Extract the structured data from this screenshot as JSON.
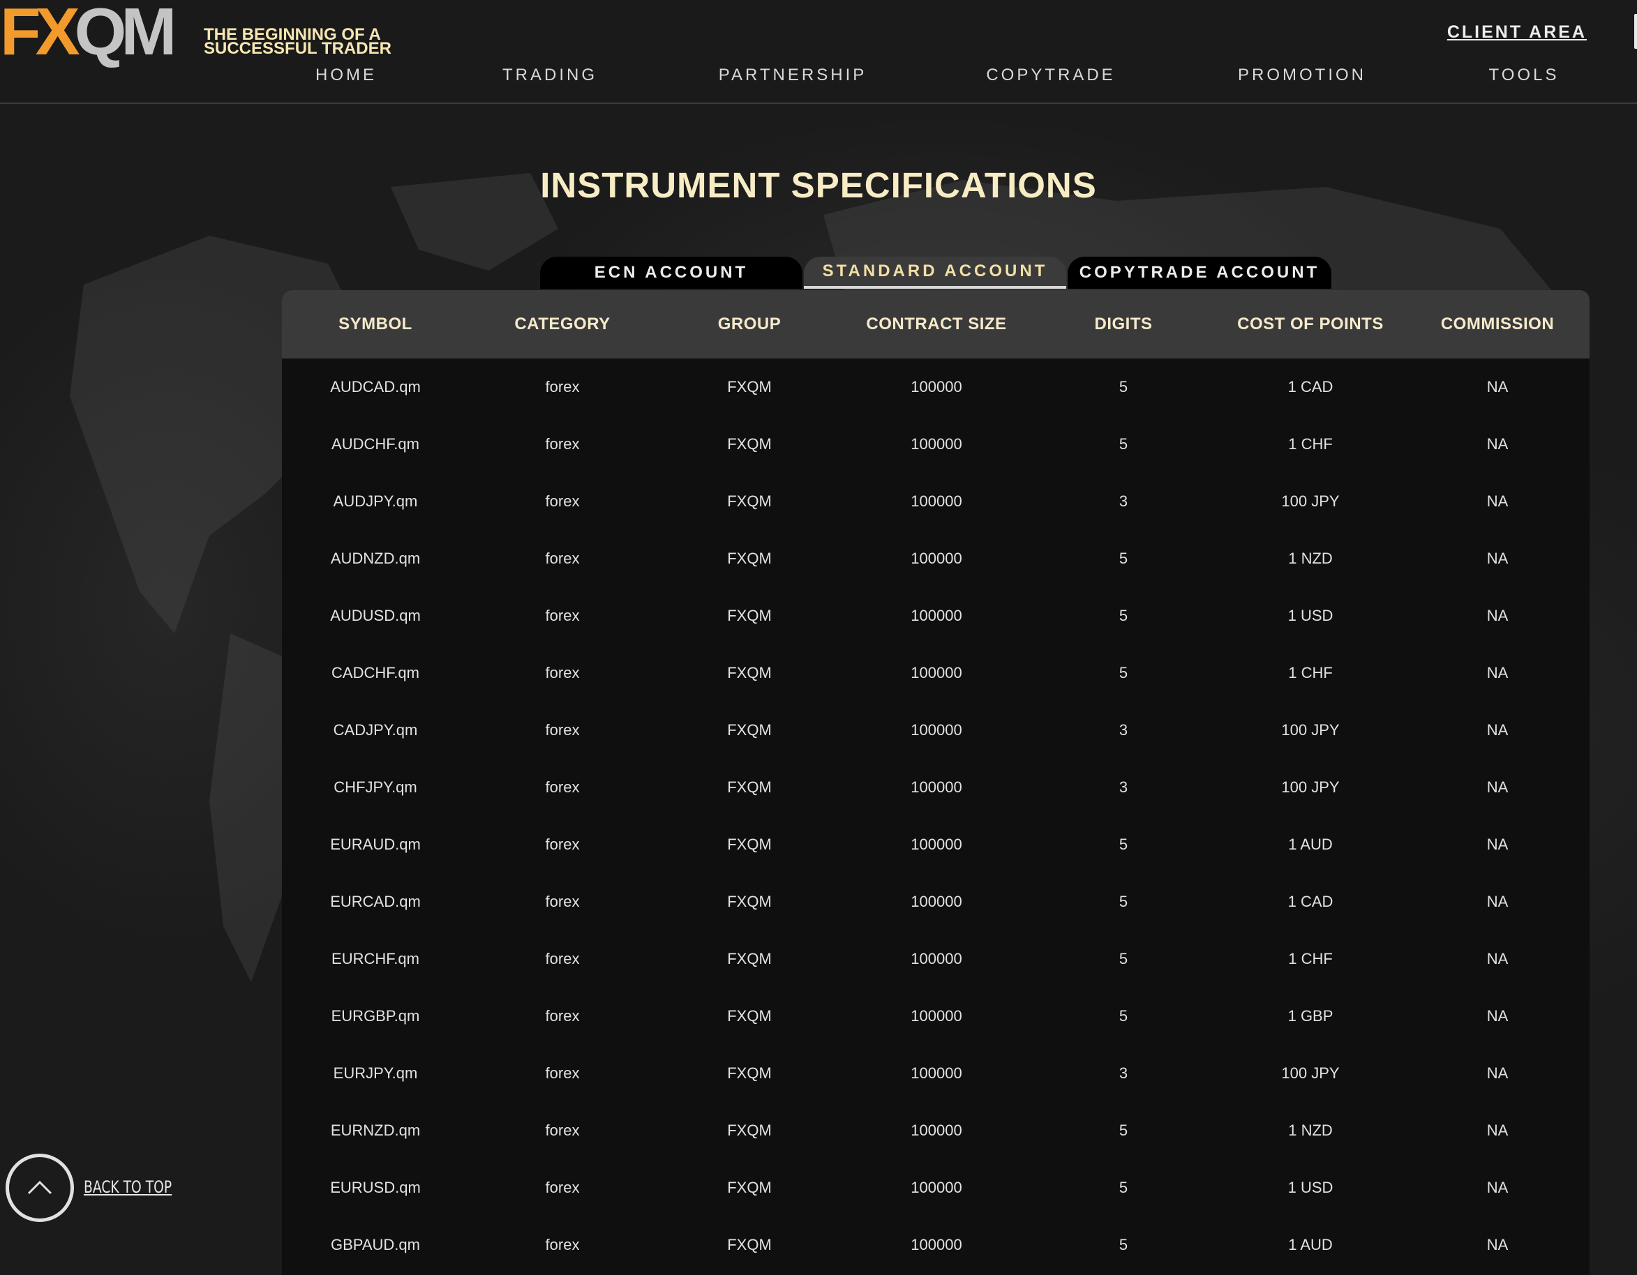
{
  "brand": {
    "logo_fx": "FX",
    "logo_qm": "QM",
    "tagline_line1": "THE BEGINNING OF A",
    "tagline_line2": "SUCCESSFUL TRADER",
    "accent_color": "#f39a2c",
    "title_color": "#f8ecc5"
  },
  "header": {
    "client_area": "CLIENT AREA",
    "nav": [
      "HOME",
      "TRADING",
      "PARTNERSHIP",
      "COPYTRADE",
      "PROMOTION",
      "TOOLS"
    ]
  },
  "page": {
    "title": "INSTRUMENT SPECIFICATIONS"
  },
  "tabs": [
    {
      "label": "ECN ACCOUNT",
      "active": false
    },
    {
      "label": "STANDARD ACCOUNT",
      "active": true
    },
    {
      "label": "COPYTRADE ACCOUNT",
      "active": false
    }
  ],
  "table": {
    "columns": [
      "SYMBOL",
      "CATEGORY",
      "GROUP",
      "CONTRACT SIZE",
      "DIGITS",
      "COST OF POINTS",
      "COMMISSION"
    ],
    "rows": [
      [
        "AUDCAD.qm",
        "forex",
        "FXQM",
        "100000",
        "5",
        "1 CAD",
        "NA"
      ],
      [
        "AUDCHF.qm",
        "forex",
        "FXQM",
        "100000",
        "5",
        "1 CHF",
        "NA"
      ],
      [
        "AUDJPY.qm",
        "forex",
        "FXQM",
        "100000",
        "3",
        "100 JPY",
        "NA"
      ],
      [
        "AUDNZD.qm",
        "forex",
        "FXQM",
        "100000",
        "5",
        "1 NZD",
        "NA"
      ],
      [
        "AUDUSD.qm",
        "forex",
        "FXQM",
        "100000",
        "5",
        "1 USD",
        "NA"
      ],
      [
        "CADCHF.qm",
        "forex",
        "FXQM",
        "100000",
        "5",
        "1 CHF",
        "NA"
      ],
      [
        "CADJPY.qm",
        "forex",
        "FXQM",
        "100000",
        "3",
        "100 JPY",
        "NA"
      ],
      [
        "CHFJPY.qm",
        "forex",
        "FXQM",
        "100000",
        "3",
        "100 JPY",
        "NA"
      ],
      [
        "EURAUD.qm",
        "forex",
        "FXQM",
        "100000",
        "5",
        "1 AUD",
        "NA"
      ],
      [
        "EURCAD.qm",
        "forex",
        "FXQM",
        "100000",
        "5",
        "1 CAD",
        "NA"
      ],
      [
        "EURCHF.qm",
        "forex",
        "FXQM",
        "100000",
        "5",
        "1 CHF",
        "NA"
      ],
      [
        "EURGBP.qm",
        "forex",
        "FXQM",
        "100000",
        "5",
        "1 GBP",
        "NA"
      ],
      [
        "EURJPY.qm",
        "forex",
        "FXQM",
        "100000",
        "3",
        "100 JPY",
        "NA"
      ],
      [
        "EURNZD.qm",
        "forex",
        "FXQM",
        "100000",
        "5",
        "1 NZD",
        "NA"
      ],
      [
        "EURUSD.qm",
        "forex",
        "FXQM",
        "100000",
        "5",
        "1 USD",
        "NA"
      ],
      [
        "GBPAUD.qm",
        "forex",
        "FXQM",
        "100000",
        "5",
        "1 AUD",
        "NA"
      ]
    ]
  },
  "back_to_top": {
    "label": "BACK TO TOP",
    "icon": "chevron-up-icon"
  }
}
